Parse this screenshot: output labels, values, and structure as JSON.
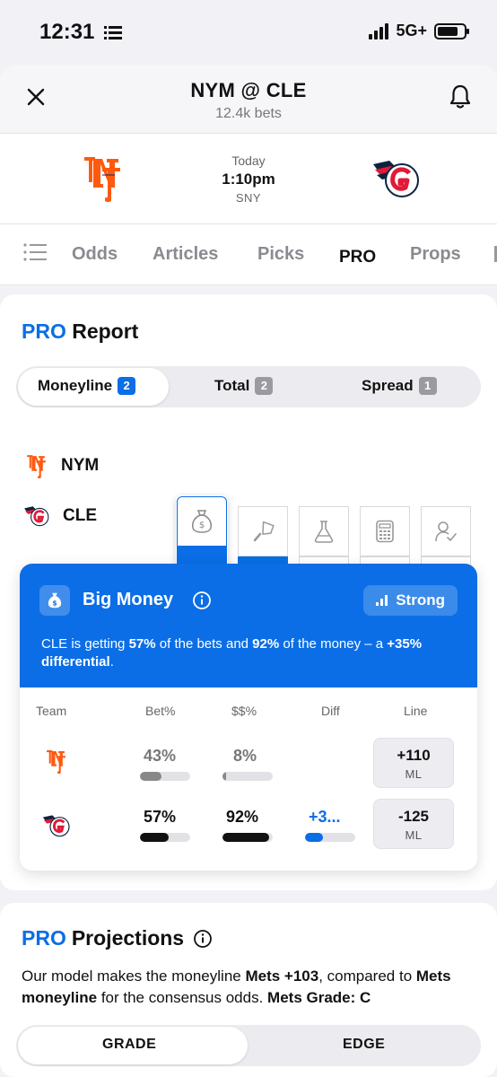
{
  "status_bar": {
    "time": "12:31",
    "network": "5G+"
  },
  "header": {
    "title": "NYM @ CLE",
    "subtitle": "12.4k bets"
  },
  "matchup": {
    "day": "Today",
    "time": "1:10pm",
    "network": "SNY"
  },
  "tabs": [
    {
      "label": "Odds"
    },
    {
      "label": "Articles"
    },
    {
      "label": "Picks"
    },
    {
      "label": "PRO"
    },
    {
      "label": "Props"
    }
  ],
  "report": {
    "title_pro": "PRO",
    "title_rest": "Report",
    "segments": [
      {
        "label": "Moneyline",
        "count": "2"
      },
      {
        "label": "Total",
        "count": "2"
      },
      {
        "label": "Spread",
        "count": "1"
      }
    ],
    "teams": [
      {
        "abbr": "NYM"
      },
      {
        "abbr": "CLE"
      }
    ]
  },
  "big_money": {
    "title": "Big Money",
    "strength": "Strong",
    "desc": {
      "p1": "CLE is getting ",
      "bets": "57%",
      "p2": " of the bets and ",
      "money": "92%",
      "p3": " of the money – a ",
      "diff": "+35% differential",
      "p4": "."
    },
    "columns": [
      "Team",
      "Bet%",
      "$$%",
      "Diff",
      "Line"
    ],
    "rows": [
      {
        "team": "NYM",
        "bet": "43%",
        "bet_value": 43,
        "money": "8%",
        "money_value": 8,
        "diff": "",
        "diff_value": 0,
        "line": "+110",
        "line_type": "ML"
      },
      {
        "team": "CLE",
        "bet": "57%",
        "bet_value": 57,
        "money": "92%",
        "money_value": 92,
        "diff": "+3...",
        "diff_value": 35,
        "line": "-125",
        "line_type": "ML"
      }
    ]
  },
  "projections": {
    "title_pro": "PRO",
    "title_rest": "Projections",
    "text": {
      "p1": "Our model makes the moneyline ",
      "b1": "Mets +103",
      "p2": ", compared to ",
      "b2": "Mets moneyline",
      "p3": " for the consensus odds. ",
      "b3": "Mets Grade: C"
    },
    "segments": [
      "GRADE",
      "EDGE"
    ]
  },
  "colors": {
    "accent": "#0b6ee6",
    "mets_orange": "#ff5910",
    "mets_blue": "#002d72",
    "guardians_red": "#e31937",
    "guardians_navy": "#0c2340"
  }
}
